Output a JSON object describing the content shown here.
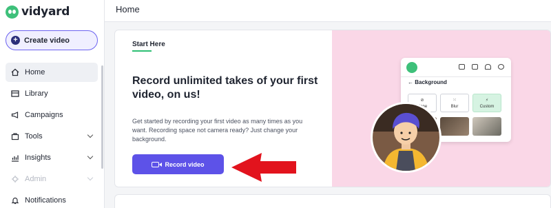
{
  "brand": {
    "name": "vidyard",
    "accent": "#3ec07a"
  },
  "sidebar": {
    "create_button": "Create video",
    "items": [
      {
        "label": "Home",
        "icon": "home-icon",
        "active": true
      },
      {
        "label": "Library",
        "icon": "library-icon"
      },
      {
        "label": "Campaigns",
        "icon": "megaphone-icon"
      },
      {
        "label": "Tools",
        "icon": "tools-icon",
        "expandable": true
      },
      {
        "label": "Insights",
        "icon": "chart-icon",
        "expandable": true
      },
      {
        "label": "Admin",
        "icon": "admin-icon",
        "expandable": true,
        "disabled": true
      },
      {
        "label": "Notifications",
        "icon": "bell-icon"
      }
    ]
  },
  "header": {
    "title": "Home"
  },
  "card": {
    "eyebrow": "Start Here",
    "headline": "Record unlimited takes of your first video, on us!",
    "description": "Get started by recording your first video as many times as you want. Recording space not camera ready? Just change your background.",
    "record_button": "Record video",
    "accent_button": "#5d52e8",
    "pink_bg": "#fad7e7"
  },
  "preview": {
    "panel_title": "Background",
    "options": [
      "None",
      "Blur",
      "Custom"
    ],
    "selected": "Custom"
  }
}
